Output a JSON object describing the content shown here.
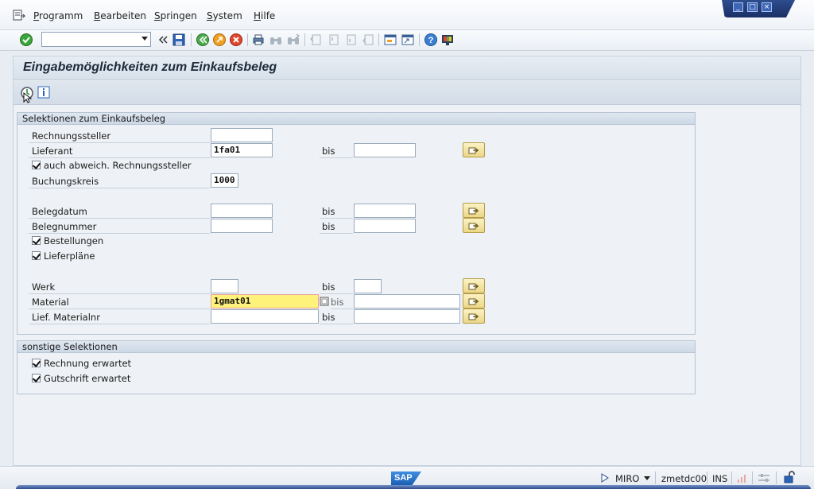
{
  "menu": {
    "items": [
      "Programm",
      "Bearbeiten",
      "Springen",
      "System",
      "Hilfe"
    ]
  },
  "window_controls": {
    "minimize": "_",
    "maximize": "□",
    "close": "×"
  },
  "toolbar": {
    "command_field_value": ""
  },
  "screen": {
    "title": "Eingabemöglichkeiten zum Einkaufsbeleg"
  },
  "frames": {
    "selection": {
      "title": "Selektionen zum Einkaufsbeleg",
      "bis_label": "bis",
      "rows": {
        "rechnungssteller": {
          "label": "Rechnungssteller",
          "value": ""
        },
        "lieferant": {
          "label": "Lieferant",
          "from": "1fa01",
          "to": ""
        },
        "abweich": {
          "label": "auch abweich. Rechnungssteller",
          "checked": true
        },
        "buchungskreis": {
          "label": "Buchungskreis",
          "value": "1000"
        },
        "belegdatum": {
          "label": "Belegdatum",
          "from": "",
          "to": ""
        },
        "belegnummer": {
          "label": "Belegnummer",
          "from": "",
          "to": ""
        },
        "bestellungen": {
          "label": "Bestellungen",
          "checked": true
        },
        "lieferplaene": {
          "label": "Lieferpläne",
          "checked": true
        },
        "werk": {
          "label": "Werk",
          "from": "",
          "to": ""
        },
        "material": {
          "label": "Material",
          "from": "1gmat01",
          "to": ""
        },
        "lief_materialnr": {
          "label": "Lief. Materialnr",
          "from": "",
          "to": ""
        }
      }
    },
    "other": {
      "title": "sonstige Selektionen",
      "rows": {
        "rechnung": {
          "label": "Rechnung erwartet",
          "checked": true
        },
        "gutschrift": {
          "label": "Gutschrift erwartet",
          "checked": true
        }
      }
    }
  },
  "statusbar": {
    "logo": "SAP",
    "transaction": "MIRO",
    "server": "zmetdc00",
    "mode": "INS"
  },
  "colors": {
    "active_field": "#fff27a",
    "frame_header": "#cdd9e6",
    "multi_button": "#ecd788"
  }
}
